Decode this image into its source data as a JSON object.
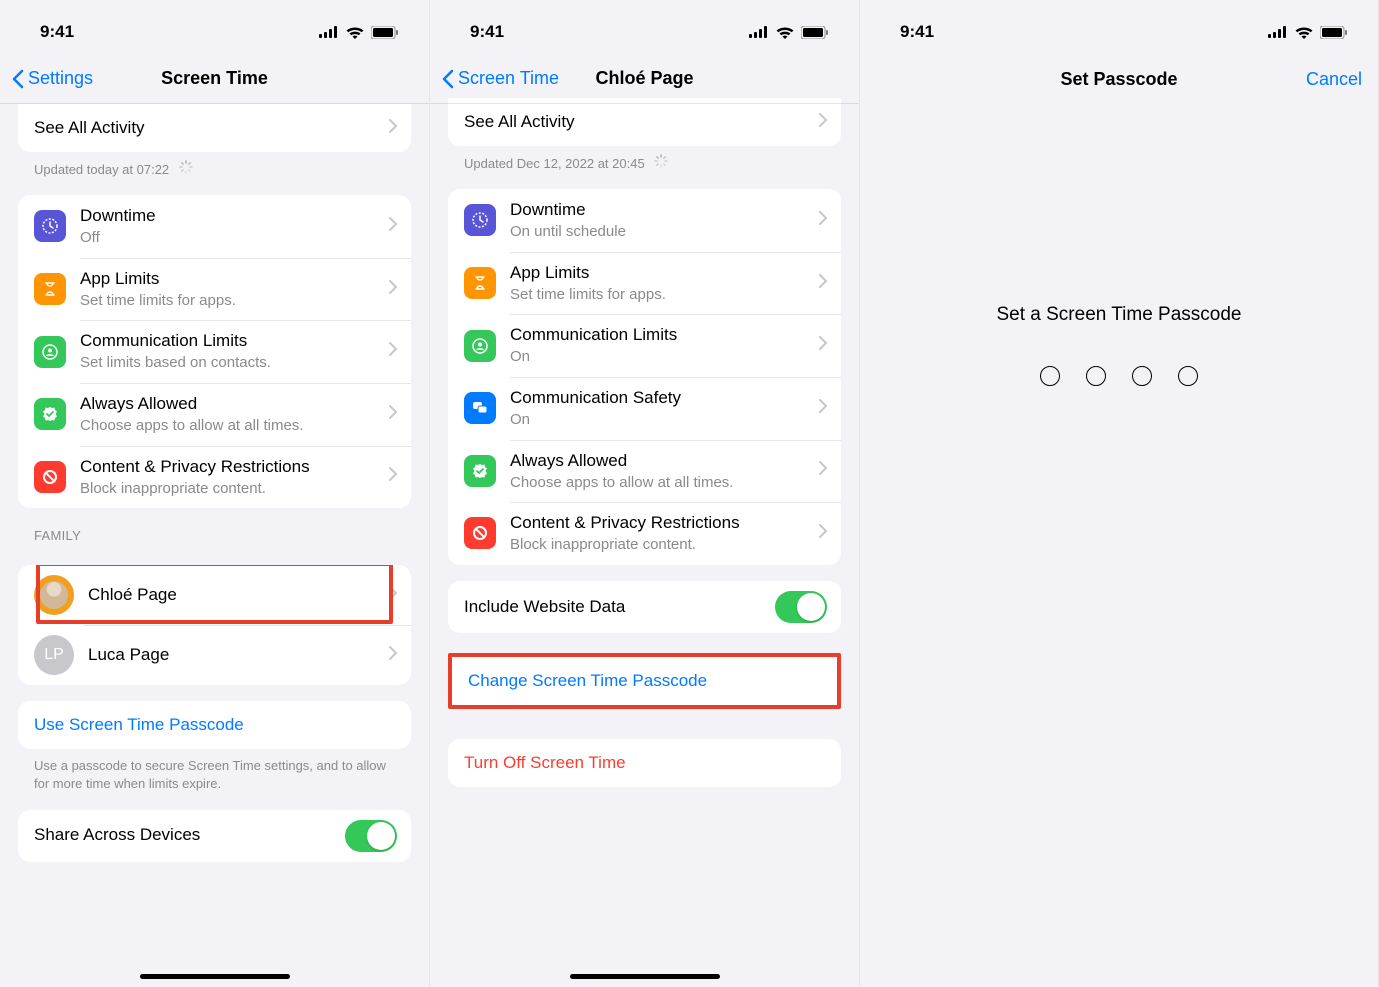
{
  "status": {
    "time": "9:41"
  },
  "panel1": {
    "back": "Settings",
    "title": "Screen Time",
    "see_all": "See All Activity",
    "updated": "Updated today at 07:22",
    "items": [
      {
        "title": "Downtime",
        "sub": "Off",
        "color": "#5856d6"
      },
      {
        "title": "App Limits",
        "sub": "Set time limits for apps.",
        "color": "#ff9500"
      },
      {
        "title": "Communication Limits",
        "sub": "Set limits based on contacts.",
        "color": "#34c759"
      },
      {
        "title": "Always Allowed",
        "sub": "Choose apps to allow at all times.",
        "color": "#34c759"
      },
      {
        "title": "Content & Privacy Restrictions",
        "sub": "Block inappropriate content.",
        "color": "#ff3b30"
      }
    ],
    "family_header": "FAMILY",
    "family": [
      {
        "name": "Chloé Page",
        "highlighted": true
      },
      {
        "name": "Luca Page",
        "initials": "LP"
      }
    ],
    "use_passcode": "Use Screen Time Passcode",
    "use_passcode_footer": "Use a passcode to secure Screen Time settings, and to allow for more time when limits expire.",
    "share_devices": "Share Across Devices"
  },
  "panel2": {
    "back": "Screen Time",
    "title": "Chloé Page",
    "see_all": "See All Activity",
    "updated": "Updated Dec 12, 2022 at 20:45",
    "items": [
      {
        "title": "Downtime",
        "sub": "On until schedule",
        "color": "#5856d6"
      },
      {
        "title": "App Limits",
        "sub": "Set time limits for apps.",
        "color": "#ff9500"
      },
      {
        "title": "Communication Limits",
        "sub": "On",
        "color": "#34c759"
      },
      {
        "title": "Communication Safety",
        "sub": "On",
        "color": "#007aff"
      },
      {
        "title": "Always Allowed",
        "sub": "Choose apps to allow at all times.",
        "color": "#34c759"
      },
      {
        "title": "Content & Privacy Restrictions",
        "sub": "Block inappropriate content.",
        "color": "#ff3b30"
      }
    ],
    "include_website_data": "Include Website Data",
    "change_passcode": "Change Screen Time Passcode",
    "turn_off": "Turn Off Screen Time"
  },
  "panel3": {
    "title": "Set Passcode",
    "cancel": "Cancel",
    "prompt": "Set a Screen Time Passcode"
  }
}
